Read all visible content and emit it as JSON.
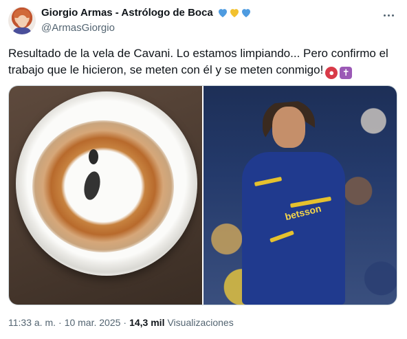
{
  "author": {
    "display_name": "Giorgio Armas - Astrólogo de Boca",
    "handle": "@ArmasGiorgio",
    "heart_colors": [
      "#4e9be0",
      "#f2c12e",
      "#4e9be0"
    ]
  },
  "tweet": {
    "text": "Resultado de la vela de Cavani. Lo estamos limpiando... Pero confirmo el trabajo que le hicieron, se meten con él y se meten conmigo!",
    "emojis": [
      "angry-face",
      "latin-cross"
    ]
  },
  "media": {
    "images": [
      "plate-with-wax-and-spice-ring",
      "soccer-player-in-blue-and-gold-kit"
    ],
    "sponsor_text": "betsson"
  },
  "footer": {
    "time": "11:33 a. m.",
    "separator": "·",
    "date": "10 mar. 2025",
    "views_count": "14,3 mil",
    "views_label": "Visualizaciones"
  }
}
